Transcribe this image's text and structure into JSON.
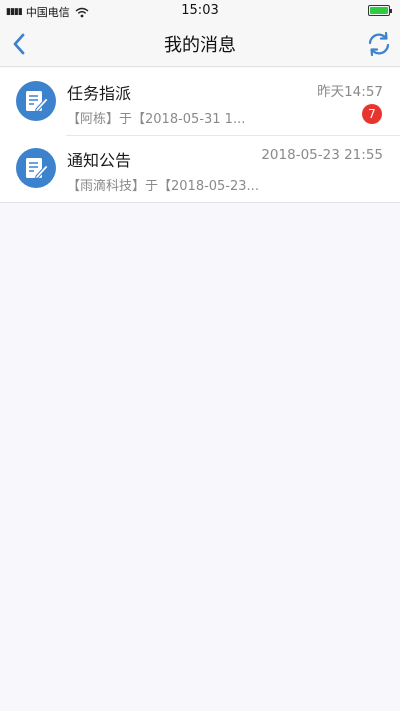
{
  "status_bar": {
    "carrier": "中国电信",
    "time": "15:03"
  },
  "navbar": {
    "title": "我的消息"
  },
  "messages": [
    {
      "title": "任务指派",
      "time": "昨天14:57",
      "preview": "【阿栋】于【2018-05-31 1...",
      "badge": "7"
    },
    {
      "title": "通知公告",
      "time": "2018-05-23 21:55",
      "preview": "【雨滴科技】于【2018-05-23..."
    }
  ],
  "colors": {
    "accent": "#3d82cc",
    "badge": "#e8342e"
  }
}
